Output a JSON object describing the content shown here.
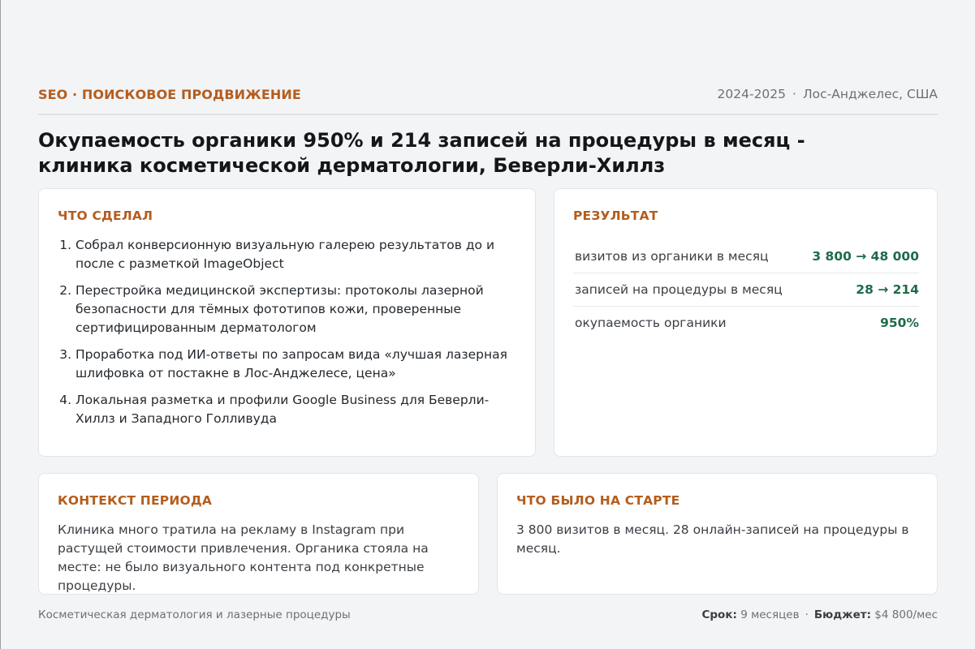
{
  "header": {
    "kicker": "SEO · ПОИСКОВОЕ ПРОДВИЖЕНИЕ",
    "years": "2024-2025",
    "separator": "·",
    "location": "Лос-Анджелес, США"
  },
  "title": "Окупаемость органики 950% и 214 записей на процедуры в месяц - клиника косметической дерматологии, Беверли-Хиллз",
  "done": {
    "heading": "ЧТО СДЕЛАЛ",
    "items": [
      "Собрал конверсионную визуальную галерею результатов до и после с разметкой ImageObject",
      "Перестройка медицинской экспертизы: протоколы лазерной безопасности для тёмных фототипов кожи, проверенные сертифицированным дерматологом",
      "Проработка под ИИ-ответы по запросам вида «лучшая лазерная шлифовка от постакне в Лос-Анджелесе, цена»",
      "Локальная разметка и профили Google Business для Беверли-Хиллз и Западного Голливуда"
    ]
  },
  "result": {
    "heading": "РЕЗУЛЬТАТ",
    "metrics": [
      {
        "label": "визитов из органики в месяц",
        "value": "3 800 → 48 000"
      },
      {
        "label": "записей на процедуры в месяц",
        "value": "28 → 214"
      },
      {
        "label": "окупаемость органики",
        "value": "950%"
      }
    ]
  },
  "context": {
    "heading": "КОНТЕКСТ ПЕРИОДА",
    "text": "Клиника много тратила на рекламу в Instagram при растущей стоимости привлечения. Органика стояла на месте: не было визуального контента под конкретные процедуры."
  },
  "start": {
    "heading": "ЧТО БЫЛО НА СТАРТЕ",
    "text": "3 800 визитов в месяц. 28 онлайн-записей на процедуры в месяц."
  },
  "footer": {
    "niche": "Косметическая дерматология и лазерные процедуры",
    "term_label": "Срок:",
    "term_value": "9 месяцев",
    "separator": "·",
    "budget_label": "Бюджет:",
    "budget_value": "$4 800/мес"
  },
  "colors": {
    "accent": "#b45d1e",
    "positive": "#1e6b4a",
    "background": "#f3f4f6"
  }
}
